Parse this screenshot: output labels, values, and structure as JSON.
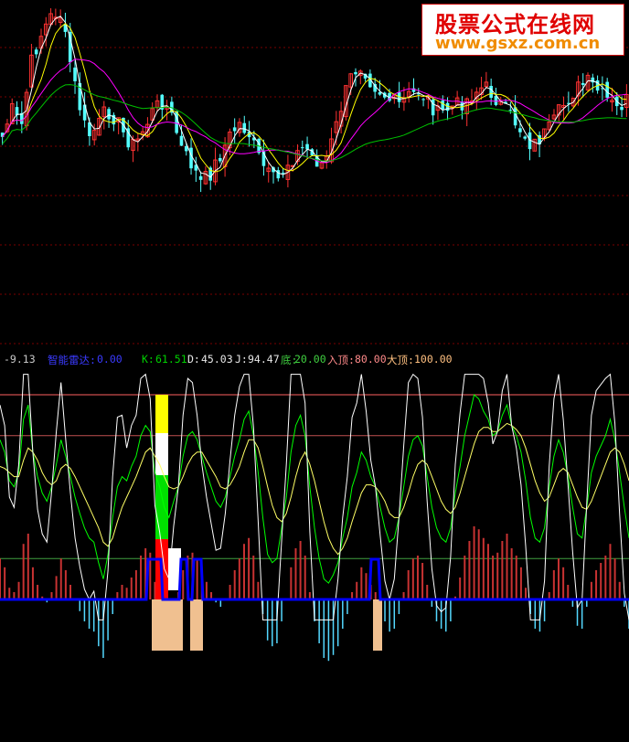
{
  "watermark": {
    "line1": "股票公式在线网",
    "line2": "www.gsxz.com.cn"
  },
  "indicator_bar": {
    "value_left": "-9.13",
    "label1": "智能雷达:",
    "value1": "0.00",
    "k_label": "K:",
    "k_value": "61.51",
    "d_label": "D:",
    "d_value": "45.03",
    "j_label": "J:",
    "j_value": "94.47",
    "bottom_label": "底:",
    "bottom_value": "20.00",
    "entry_top_label": "入顶:",
    "entry_top_value": "80.00",
    "big_top_label": "大顶:",
    "big_top_value": "100.00"
  },
  "colors": {
    "background": "#000000",
    "up_candle": "#ff3232",
    "down_candle": "#54ffff",
    "ma_short": "#ffffff",
    "ma_mid": "#ffff00",
    "ma_long": "#ff00ff",
    "ma_longest": "#00c000",
    "k_line": "#ffffff",
    "d_line": "#ffff66",
    "j_line": "#00ff00",
    "blue_line": "#0000ff",
    "hist_pos": "#c83232",
    "hist_neg": "#54d8ff",
    "tan_block": "#f0c090",
    "ref_line_100": "#ff6060",
    "ref_line_80": "#c05050",
    "ref_line_20": "#40a040"
  },
  "chart_data": {
    "type": "line",
    "title": "",
    "reference_levels": [
      100,
      80,
      20
    ],
    "kdj_range": [
      -10,
      110
    ],
    "k_series": [
      78,
      72,
      58,
      55,
      62,
      88,
      95,
      72,
      60,
      52,
      48,
      55,
      66,
      78,
      70,
      60,
      50,
      42,
      35,
      30,
      28,
      18,
      10,
      22,
      40,
      55,
      60,
      58,
      65,
      70,
      80,
      85,
      82,
      62,
      55,
      45,
      40,
      48,
      55,
      70,
      80,
      82,
      78,
      70,
      62,
      55,
      48,
      45,
      50,
      60,
      70,
      78,
      88,
      92,
      80,
      62,
      40,
      22,
      18,
      20,
      35,
      50,
      72,
      85,
      90,
      80,
      55,
      35,
      20,
      10,
      8,
      12,
      18,
      30,
      40,
      55,
      62,
      72,
      68,
      60,
      55,
      45,
      35,
      28,
      30,
      40,
      55,
      70,
      78,
      80,
      75,
      60,
      45,
      35,
      30,
      28,
      35,
      52,
      65,
      80,
      90,
      100,
      98,
      92,
      88,
      80,
      82,
      90,
      95,
      85,
      80,
      72,
      58,
      40,
      30,
      28,
      35,
      55,
      70,
      78,
      72,
      60,
      45,
      32,
      30,
      45,
      62,
      70,
      75,
      80,
      88,
      78,
      62,
      45,
      30
    ],
    "d_series": [
      65,
      64,
      62,
      60,
      60,
      68,
      74,
      72,
      68,
      62,
      58,
      56,
      58,
      64,
      66,
      64,
      60,
      55,
      50,
      45,
      40,
      35,
      28,
      26,
      30,
      38,
      45,
      50,
      55,
      60,
      66,
      72,
      74,
      70,
      66,
      60,
      55,
      54,
      55,
      60,
      66,
      70,
      72,
      72,
      68,
      64,
      60,
      55,
      54,
      56,
      60,
      65,
      72,
      78,
      78,
      74,
      65,
      55,
      46,
      40,
      38,
      42,
      50,
      60,
      68,
      72,
      66,
      58,
      48,
      38,
      30,
      25,
      22,
      25,
      30,
      38,
      45,
      52,
      56,
      56,
      55,
      52,
      48,
      42,
      40,
      40,
      45,
      52,
      60,
      66,
      68,
      66,
      60,
      54,
      48,
      44,
      42,
      45,
      52,
      60,
      68,
      76,
      82,
      84,
      84,
      82,
      82,
      84,
      86,
      85,
      83,
      80,
      74,
      66,
      58,
      52,
      48,
      50,
      56,
      62,
      64,
      62,
      56,
      50,
      45,
      44,
      48,
      54,
      60,
      66,
      72,
      74,
      72,
      66,
      58
    ],
    "j_series": [
      95,
      85,
      50,
      45,
      66,
      115,
      125,
      72,
      44,
      32,
      28,
      53,
      82,
      106,
      78,
      52,
      30,
      16,
      5,
      0,
      4,
      -10,
      -10,
      14,
      60,
      89,
      90,
      74,
      85,
      90,
      108,
      111,
      98,
      46,
      33,
      15,
      10,
      36,
      55,
      90,
      108,
      106,
      90,
      66,
      50,
      37,
      24,
      25,
      42,
      68,
      90,
      104,
      120,
      120,
      84,
      38,
      -10,
      -10,
      -10,
      -10,
      29,
      66,
      116,
      120,
      120,
      96,
      33,
      -10,
      -10,
      -10,
      -10,
      -10,
      10,
      40,
      60,
      89,
      96,
      112,
      92,
      68,
      55,
      31,
      9,
      0,
      10,
      40,
      75,
      106,
      114,
      108,
      89,
      48,
      15,
      -3,
      -6,
      -4,
      21,
      66,
      91,
      120,
      120,
      120,
      120,
      108,
      96,
      76,
      82,
      102,
      113,
      85,
      74,
      56,
      26,
      -10,
      -10,
      -10,
      9,
      65,
      98,
      110,
      88,
      56,
      23,
      -4,
      0,
      47,
      90,
      102,
      105,
      108,
      120,
      86,
      42,
      3,
      -10
    ]
  }
}
